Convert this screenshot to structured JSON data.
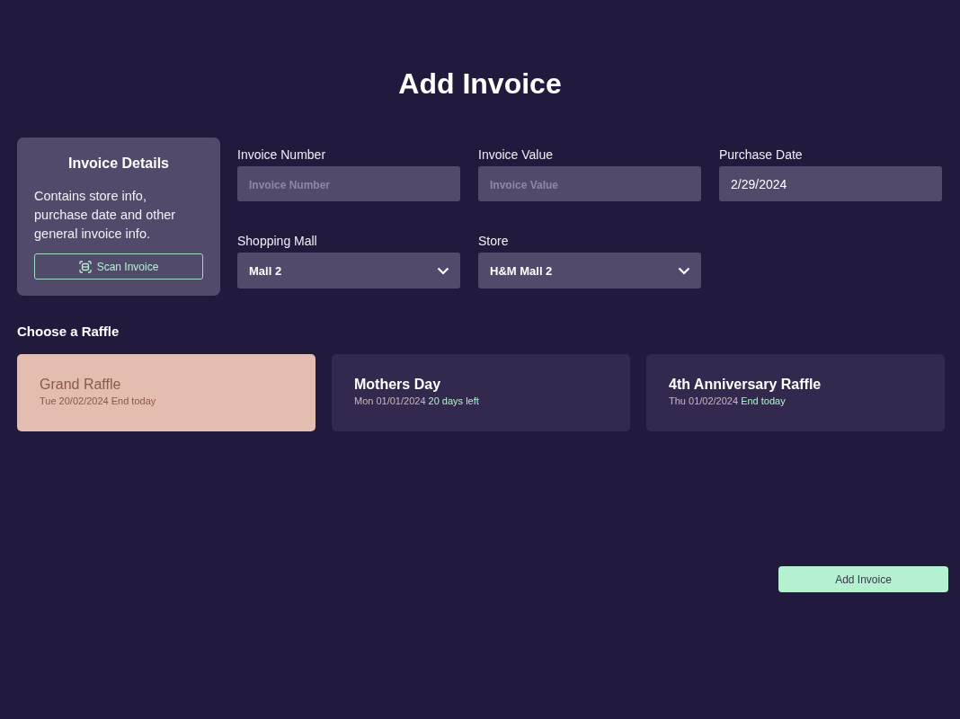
{
  "title": "Add Invoice",
  "details_card": {
    "title": "Invoice Details",
    "description": "Contains store info, purchase date and other general invoice info.",
    "scan_button": "Scan Invoice"
  },
  "fields": [
    {
      "kind": "text",
      "label": "Invoice Number",
      "placeholder": "Invoice Number"
    },
    {
      "kind": "text",
      "label": "Invoice Value",
      "placeholder": "Invoice Value"
    },
    {
      "kind": "text",
      "label": "Purchase Date",
      "value": "2/29/2024"
    },
    {
      "kind": "select",
      "label": "Shopping Mall",
      "value": "Mall 2"
    },
    {
      "kind": "select",
      "label": "Store",
      "value": "H&M Mall 2"
    }
  ],
  "raffle_heading": "Choose a Raffle",
  "raffles": [
    {
      "name": "Grand Raffle",
      "date": "Tue 20/02/2024",
      "status": "End today",
      "selected": true
    },
    {
      "name": "Mothers Day",
      "date": "Mon 01/01/2024",
      "status": "20 days left",
      "selected": false
    },
    {
      "name": "4th Anniversary Raffle",
      "date": "Thu 01/02/2024",
      "status": "End today",
      "selected": false
    }
  ],
  "submit_button": "Add Invoice"
}
